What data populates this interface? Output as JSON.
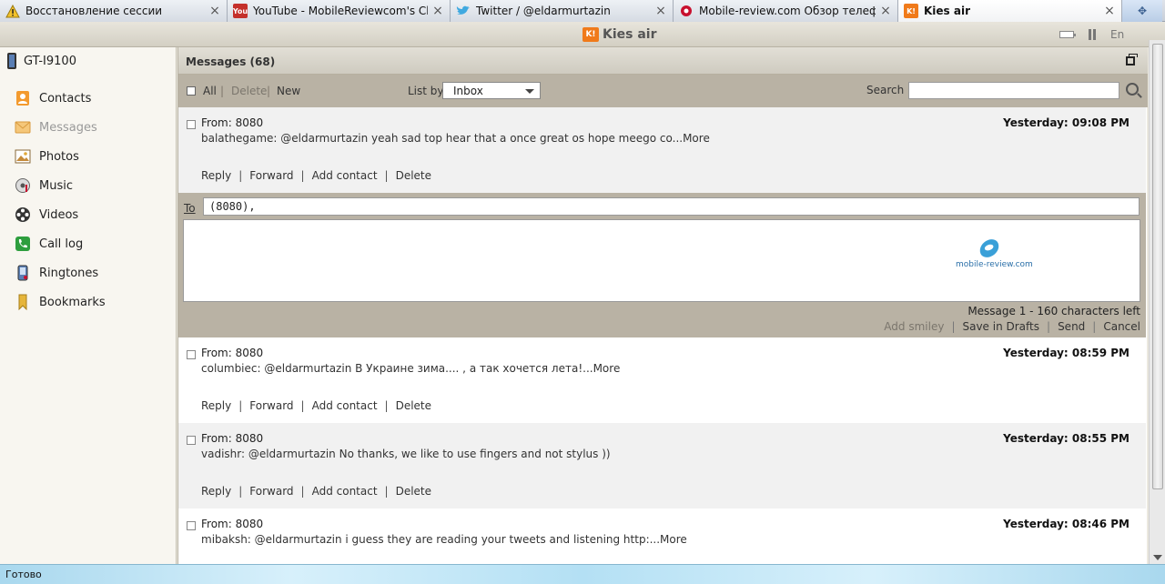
{
  "browser": {
    "tabs": [
      {
        "label": "Восстановление сессии",
        "icon": "warning-icon",
        "active": false
      },
      {
        "label": "YouTube - MobileReviewcom's Ch...",
        "icon": "youtube-icon",
        "active": false
      },
      {
        "label": "Twitter / @eldarmurtazin",
        "icon": "twitter-icon",
        "active": false
      },
      {
        "label": "Mobile-review.com Обзор телефо...",
        "icon": "mobile-review-icon",
        "active": false
      },
      {
        "label": "Kies air",
        "icon": "kies-icon",
        "active": true
      }
    ],
    "status": "Готово"
  },
  "kies": {
    "logo_badge": "K!",
    "logo_text": "Kies air",
    "language": "En"
  },
  "sidebar": {
    "device": "GT-I9100",
    "items": [
      {
        "label": "Contacts",
        "icon": "contacts-icon"
      },
      {
        "label": "Messages",
        "icon": "messages-icon"
      },
      {
        "label": "Photos",
        "icon": "photos-icon"
      },
      {
        "label": "Music",
        "icon": "music-icon"
      },
      {
        "label": "Videos",
        "icon": "videos-icon"
      },
      {
        "label": "Call log",
        "icon": "call-log-icon"
      },
      {
        "label": "Ringtones",
        "icon": "ringtones-icon"
      },
      {
        "label": "Bookmarks",
        "icon": "bookmarks-icon"
      }
    ]
  },
  "messages": {
    "title": "Messages (68)",
    "toolbar": {
      "all": "All",
      "delete": "Delete",
      "new": "New",
      "list_by": "List by",
      "list_value": "Inbox",
      "search_label": "Search",
      "search_value": ""
    },
    "from_label": "From:",
    "actions": {
      "reply": "Reply",
      "forward": "Forward",
      "add_contact": "Add contact",
      "delete": "Delete"
    },
    "list": [
      {
        "from": "8080",
        "time": "Yesterday: 09:08 PM",
        "text": "balathegame: @eldarmurtazin yeah sad top hear that a once great os hope meego co...More"
      },
      {
        "from": "8080",
        "time": "Yesterday: 08:59 PM",
        "text": "columbiec: @eldarmurtazin В Украине зима.... , а так хочется лета!...More"
      },
      {
        "from": "8080",
        "time": "Yesterday: 08:55 PM",
        "text": "vadishr: @eldarmurtazin No thanks, we like to use fingers and not stylus ))"
      },
      {
        "from": "8080",
        "time": "Yesterday: 08:46 PM",
        "text": "mibaksh: @eldarmurtazin i guess they are reading your tweets and listening http:...More"
      }
    ],
    "composer": {
      "to_label": "To",
      "to_value": "(8080),",
      "watermark": "mobile-review.com",
      "counter": "Message 1 - 160 characters left",
      "add_smiley": "Add smiley",
      "save_drafts": "Save in Drafts",
      "send": "Send",
      "cancel": "Cancel"
    }
  }
}
